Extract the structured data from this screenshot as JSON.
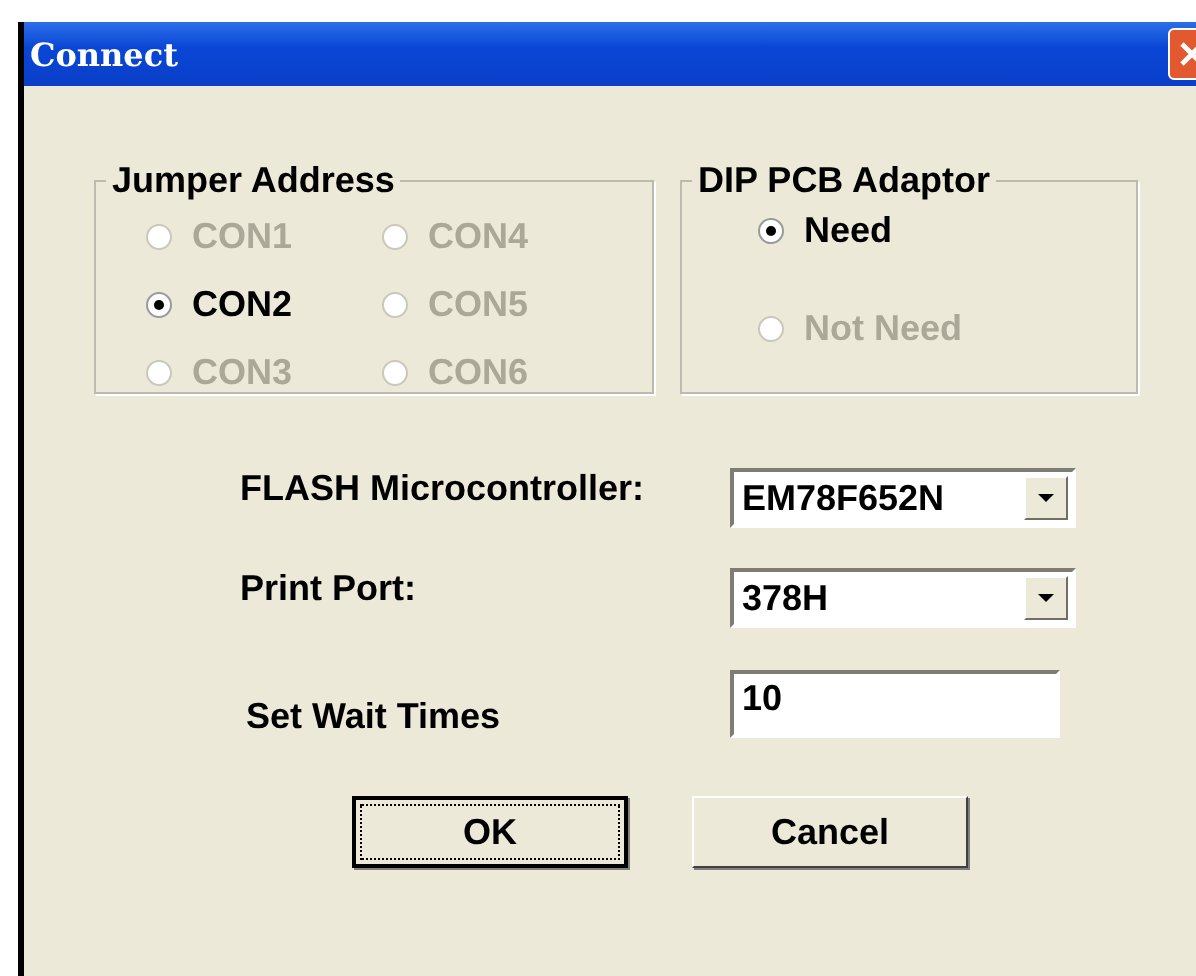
{
  "window": {
    "title": "Connect"
  },
  "jumper_address": {
    "title": "Jumper Address",
    "options": [
      {
        "label": "CON1",
        "selected": false,
        "disabled": true
      },
      {
        "label": "CON2",
        "selected": true,
        "disabled": false
      },
      {
        "label": "CON3",
        "selected": false,
        "disabled": true
      },
      {
        "label": "CON4",
        "selected": false,
        "disabled": true
      },
      {
        "label": "CON5",
        "selected": false,
        "disabled": true
      },
      {
        "label": "CON6",
        "selected": false,
        "disabled": true
      }
    ]
  },
  "dip_pcb_adaptor": {
    "title": "DIP PCB Adaptor",
    "options": [
      {
        "label": "Need",
        "selected": true,
        "disabled": false
      },
      {
        "label": "Not Need",
        "selected": false,
        "disabled": true
      }
    ]
  },
  "fields": [
    {
      "kind": "dropdown",
      "label": "FLASH Microcontroller:",
      "value": "EM78F652N"
    },
    {
      "kind": "dropdown",
      "label": "Print Port:",
      "value": "378H"
    },
    {
      "kind": "text",
      "label": "Set Wait Times",
      "value": "10"
    }
  ],
  "buttons": [
    {
      "label": "OK",
      "focused": true
    },
    {
      "label": "Cancel",
      "focused": false
    }
  ]
}
